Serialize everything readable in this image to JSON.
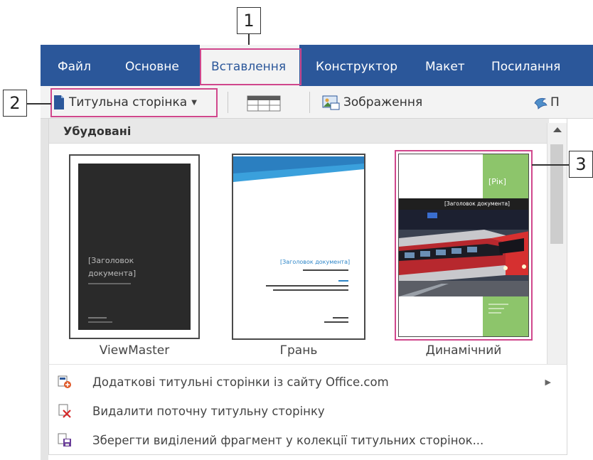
{
  "callouts": {
    "one": "1",
    "two": "2",
    "three": "3"
  },
  "ribbon": {
    "tabs": [
      {
        "label": "Файл"
      },
      {
        "label": "Основне"
      },
      {
        "label": "Вставлення"
      },
      {
        "label": "Конструктор"
      },
      {
        "label": "Макет"
      },
      {
        "label": "Посилання"
      }
    ],
    "active_tab": "Вставлення"
  },
  "toolbar": {
    "cover_page_label": "Титульна сторінка",
    "pictures_label": "Зображення",
    "cut_label": "П"
  },
  "gallery": {
    "section_title": "Убудовані",
    "items": [
      {
        "name": "ViewMaster",
        "title_line1": "[Заголовок",
        "title_line2": "документа]"
      },
      {
        "name": "Грань",
        "title": "[Заголовок документа]"
      },
      {
        "name": "Динамічний",
        "year": "[Рік]",
        "title": "[Заголовок документа]"
      }
    ]
  },
  "menu": {
    "items": [
      {
        "label": "Додаткові титульні сторінки із сайту Office.com",
        "has_submenu": true
      },
      {
        "label": "Видалити поточну титульну сторінку",
        "has_submenu": false
      },
      {
        "label": "Зберегти виділений фрагмент у колекції титульних сторінок...",
        "has_submenu": false
      }
    ]
  },
  "colors": {
    "ribbon_blue": "#2b579a",
    "callout_highlight": "#d0478c",
    "dynamic_green": "#8dc56b"
  }
}
